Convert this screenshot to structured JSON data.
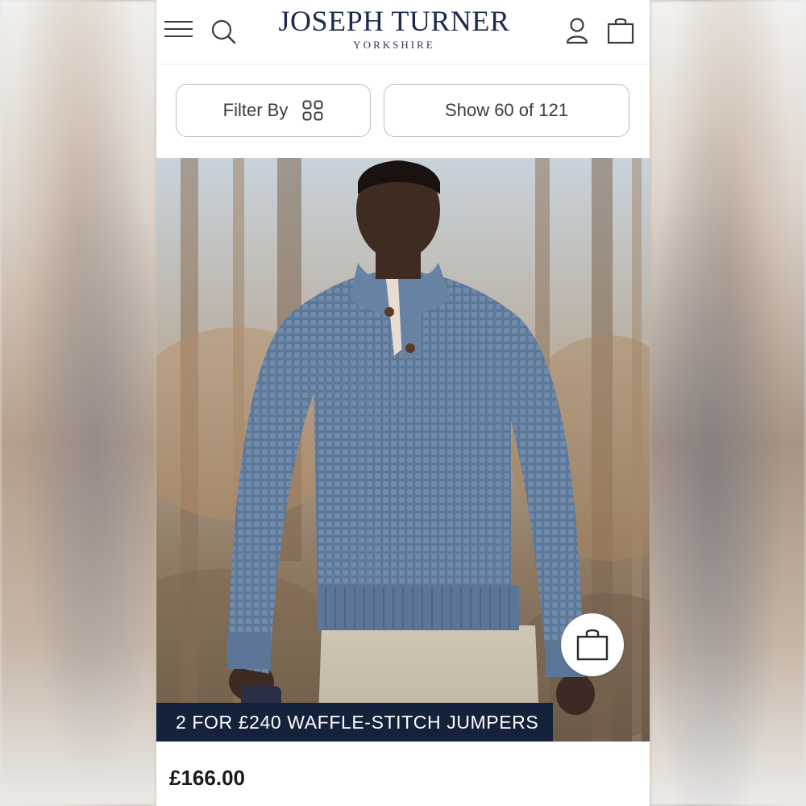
{
  "header": {
    "brand_name": "JOSEPH TURNER",
    "brand_sub": "YORKSHIRE",
    "icons": [
      "menu-icon",
      "search-icon",
      "account-icon",
      "bag-icon"
    ]
  },
  "controls": {
    "filter_label": "Filter By",
    "show_label": "Show 60 of 121"
  },
  "product": {
    "promo_text": "2 FOR £240 WAFFLE-STITCH JUMPERS",
    "price": "£166.00",
    "quick_add_icon": "shopping-bag-icon"
  },
  "colors": {
    "brand_navy": "#1b2a4e",
    "banner_navy": "#15223b",
    "jumper_blue": "#5b7699"
  }
}
